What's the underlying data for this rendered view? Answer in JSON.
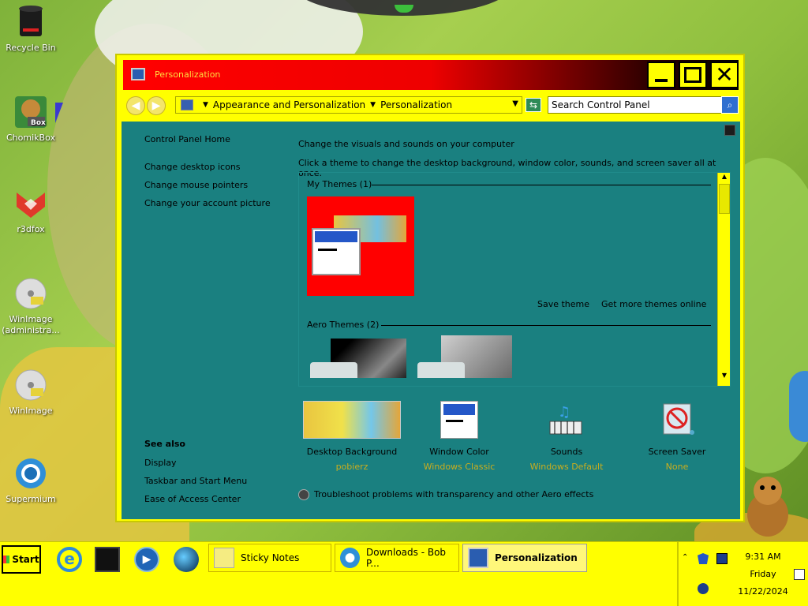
{
  "desktop": {
    "icons": [
      {
        "label": "Recycle Bin",
        "icon": "trash-can-icon"
      },
      {
        "label": "ChomikBox",
        "icon": "hamster-box-icon"
      },
      {
        "label": "r3dfox",
        "icon": "red-fox-icon"
      },
      {
        "label": "WinImage (administra...",
        "icon": "disc-icon"
      },
      {
        "label": "WinImage",
        "icon": "disc-icon"
      },
      {
        "label": "Supermium",
        "icon": "supermium-browser-icon"
      }
    ]
  },
  "window": {
    "title": "Personalization",
    "breadcrumb": [
      "Appearance and Personalization",
      "Personalization"
    ],
    "search_placeholder": "Search Control Panel",
    "left_links": [
      "Control Panel Home",
      "Change desktop icons",
      "Change mouse pointers",
      "Change your account picture"
    ],
    "see_also_title": "See also",
    "see_also_links": [
      "Display",
      "Taskbar and Start Menu",
      "Ease of Access Center"
    ],
    "intro_title": "Change the visuals and sounds on your computer",
    "intro_text": "Click a theme to change the desktop background, window color, sounds, and screen saver all at once.",
    "my_themes_label": "My Themes (1)",
    "aero_themes_label": "Aero Themes (2)",
    "save_theme": "Save theme",
    "more_themes": "Get more themes online",
    "tiles": [
      {
        "label": "Desktop Background",
        "value": "pobierz"
      },
      {
        "label": "Window Color",
        "value": "Windows Classic"
      },
      {
        "label": "Sounds",
        "value": "Windows Default"
      },
      {
        "label": "Screen Saver",
        "value": "None"
      }
    ],
    "troubleshoot": "Troubleshoot problems with transparency and other Aero effects"
  },
  "taskbar": {
    "start_label": "Start",
    "tasks": [
      {
        "label": "Sticky Notes",
        "active": false
      },
      {
        "label": "Downloads - Bob P...",
        "active": false
      },
      {
        "label": "Personalization",
        "active": true
      }
    ],
    "clock": {
      "time": "9:31 AM",
      "day": "Friday",
      "date": "11/22/2024"
    }
  },
  "colors": {
    "accent": "#ffff00",
    "content_bg": "#1a8080",
    "title_gradient_start": "#ff0000",
    "value_text": "#c9ad1e"
  }
}
